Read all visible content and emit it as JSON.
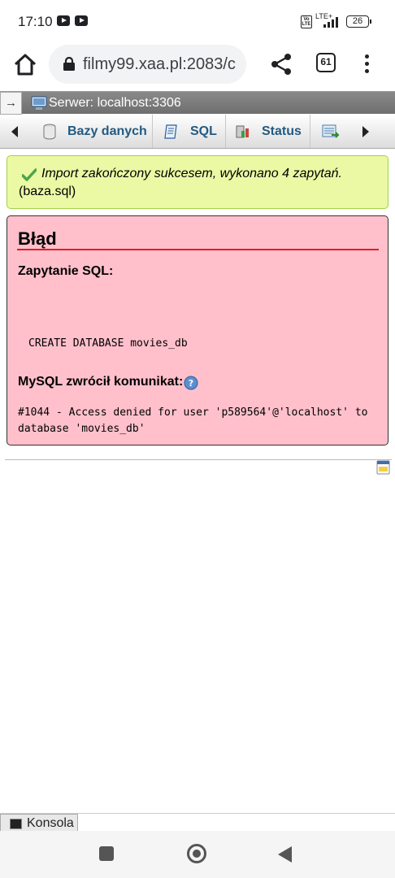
{
  "status_bar": {
    "time": "17:10",
    "volte": "Vo LTE",
    "network": "LTE+",
    "battery": "26"
  },
  "browser": {
    "url": "filmy99.xaa.pl:2083/c",
    "tab_count": "61"
  },
  "server_bar": {
    "collapse_symbol": "→",
    "server": "Serwer: localhost:3306"
  },
  "top_menu": {
    "tabs": [
      {
        "label": "Bazy danych",
        "icon": "database-icon"
      },
      {
        "label": "SQL",
        "icon": "sql-icon"
      },
      {
        "label": "Status",
        "icon": "status-icon"
      },
      {
        "label": "",
        "icon": "export-icon"
      }
    ]
  },
  "success": {
    "message": "Import zakończony sukcesem, wykonano 4 zapytań.",
    "file": "(baza.sql)"
  },
  "error": {
    "title": "Błąd",
    "sql_label": "Zapytanie SQL:",
    "query": "CREATE DATABASE movies_db",
    "mysql_label": "MySQL zwrócił komunikat:",
    "message": "#1044 - Access denied for user 'p589564'@'localhost' to database 'movies_db'"
  },
  "console": {
    "label": "Konsola"
  },
  "colors": {
    "success_bg": "#ebf8a4",
    "error_bg": "#ffc0cb",
    "error_rule": "#e21a2c",
    "link": "#235a81"
  }
}
